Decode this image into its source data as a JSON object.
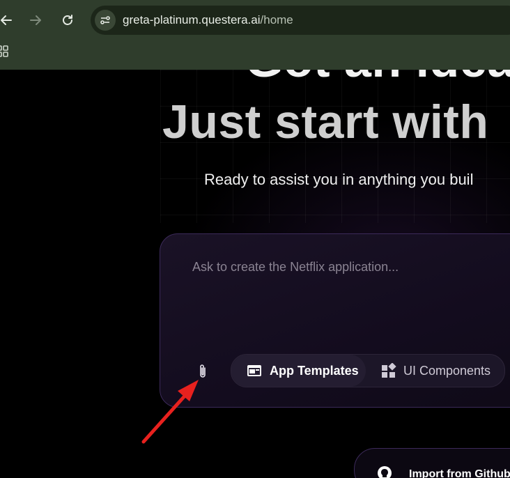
{
  "browser": {
    "url_domain": "greta-platinum.questera.ai",
    "url_path": "/home"
  },
  "hero": {
    "headline_partial": "Got an idea",
    "headline": "Just start with",
    "subtitle": "Ready to assist you in anything you buil"
  },
  "prompt": {
    "placeholder": "Ask to create the Netflix application..."
  },
  "tabs": [
    {
      "label": "App Templates",
      "icon": "app-window-icon"
    },
    {
      "label": "UI Components",
      "icon": "components-icon"
    }
  ],
  "import_button": {
    "label": "Import from Github",
    "icon": "github-icon"
  },
  "annotation": {
    "color": "#e8211e",
    "icon": "red-arrow"
  },
  "colors": {
    "chrome": "#2f3d2c",
    "card_border": "#3c2a5a",
    "background": "#000000"
  }
}
